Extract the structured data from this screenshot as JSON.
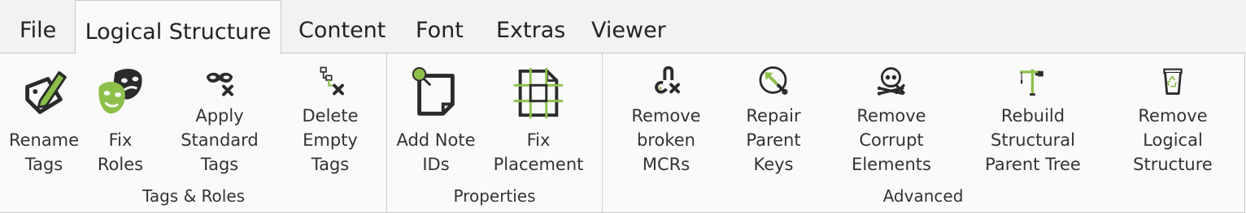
{
  "tabs": [
    {
      "label": "File"
    },
    {
      "label": "Logical Structure"
    },
    {
      "label": "Content"
    },
    {
      "label": "Font"
    },
    {
      "label": "Extras"
    },
    {
      "label": "Viewer"
    }
  ],
  "active_tab": "Logical Structure",
  "groups": [
    {
      "label": "Tags & Roles",
      "buttons": [
        {
          "label": "Rename\nTags",
          "icon": "rename-tags-icon"
        },
        {
          "label": "Fix Roles",
          "icon": "theater-masks-icon"
        },
        {
          "label": "Apply\nStandard Tags",
          "icon": "mask-x-icon"
        },
        {
          "label": "Delete\nEmpty Tags",
          "icon": "tree-x-icon"
        }
      ]
    },
    {
      "label": "Properties",
      "buttons": [
        {
          "label": "Add Note\nIDs",
          "icon": "note-pin-icon"
        },
        {
          "label": "Fix Placement",
          "icon": "placement-icon"
        }
      ]
    },
    {
      "label": "Advanced",
      "buttons": [
        {
          "label": "Remove\nbroken MCRs",
          "icon": "broken-magnet-icon"
        },
        {
          "label": "Repair\nParent Keys",
          "icon": "wrench-arrow-icon"
        },
        {
          "label": "Remove Corrupt\nElements",
          "icon": "skull-icon"
        },
        {
          "label": "Rebuild Structural\nParent Tree",
          "icon": "crane-icon"
        },
        {
          "label": "Remove Logical\nStructure",
          "icon": "recycle-bin-icon"
        }
      ]
    }
  ],
  "colors": {
    "accent_green": "#8cc04b",
    "icon_dark": "#2b2b2b"
  }
}
